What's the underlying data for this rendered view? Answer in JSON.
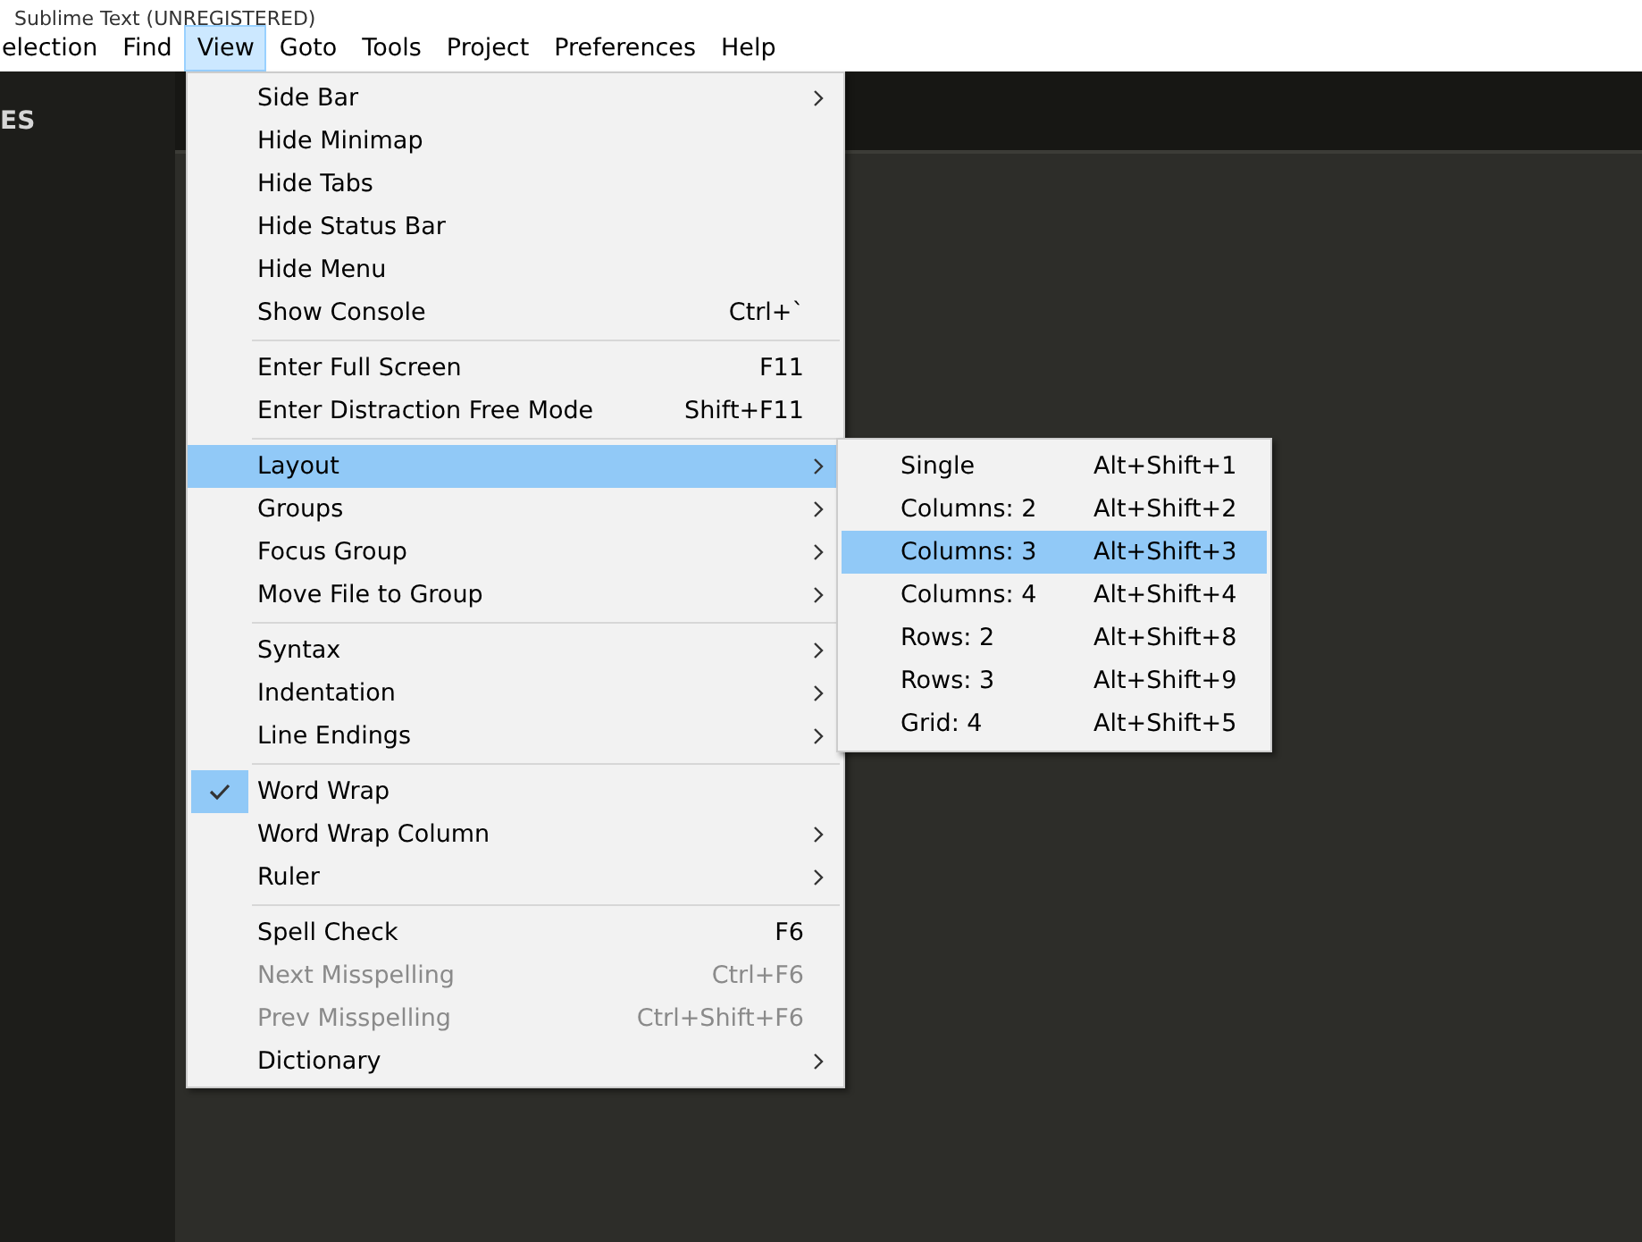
{
  "window": {
    "title": "Sublime Text (UNREGISTERED)"
  },
  "menubar": [
    {
      "label": "election",
      "selected": false
    },
    {
      "label": "Find",
      "selected": false
    },
    {
      "label": "View",
      "selected": true
    },
    {
      "label": "Goto",
      "selected": false
    },
    {
      "label": "Tools",
      "selected": false
    },
    {
      "label": "Project",
      "selected": false
    },
    {
      "label": "Preferences",
      "selected": false
    },
    {
      "label": "Help",
      "selected": false
    }
  ],
  "sidebar": {
    "heading": "ES"
  },
  "view_menu": {
    "sections": [
      [
        {
          "label": "Side Bar",
          "kind": "submenu",
          "selected": false,
          "checked": false,
          "disabled": false
        },
        {
          "label": "Hide Minimap",
          "kind": "item",
          "selected": false,
          "checked": false,
          "disabled": false
        },
        {
          "label": "Hide Tabs",
          "kind": "item",
          "selected": false,
          "checked": false,
          "disabled": false
        },
        {
          "label": "Hide Status Bar",
          "kind": "item",
          "selected": false,
          "checked": false,
          "disabled": false
        },
        {
          "label": "Hide Menu",
          "kind": "item",
          "selected": false,
          "checked": false,
          "disabled": false
        },
        {
          "label": "Show Console",
          "kind": "item",
          "shortcut": "Ctrl+`",
          "selected": false,
          "checked": false,
          "disabled": false
        }
      ],
      [
        {
          "label": "Enter Full Screen",
          "kind": "item",
          "shortcut": "F11",
          "selected": false,
          "checked": false,
          "disabled": false
        },
        {
          "label": "Enter Distraction Free Mode",
          "kind": "item",
          "shortcut": "Shift+F11",
          "selected": false,
          "checked": false,
          "disabled": false
        }
      ],
      [
        {
          "label": "Layout",
          "kind": "submenu",
          "selected": true,
          "checked": false,
          "disabled": false
        },
        {
          "label": "Groups",
          "kind": "submenu",
          "selected": false,
          "checked": false,
          "disabled": false
        },
        {
          "label": "Focus Group",
          "kind": "submenu",
          "selected": false,
          "checked": false,
          "disabled": false
        },
        {
          "label": "Move File to Group",
          "kind": "submenu",
          "selected": false,
          "checked": false,
          "disabled": false
        }
      ],
      [
        {
          "label": "Syntax",
          "kind": "submenu",
          "selected": false,
          "checked": false,
          "disabled": false
        },
        {
          "label": "Indentation",
          "kind": "submenu",
          "selected": false,
          "checked": false,
          "disabled": false
        },
        {
          "label": "Line Endings",
          "kind": "submenu",
          "selected": false,
          "checked": false,
          "disabled": false
        }
      ],
      [
        {
          "label": "Word Wrap",
          "kind": "item",
          "selected": false,
          "checked": true,
          "disabled": false
        },
        {
          "label": "Word Wrap Column",
          "kind": "submenu",
          "selected": false,
          "checked": false,
          "disabled": false
        },
        {
          "label": "Ruler",
          "kind": "submenu",
          "selected": false,
          "checked": false,
          "disabled": false
        }
      ],
      [
        {
          "label": "Spell Check",
          "kind": "item",
          "shortcut": "F6",
          "selected": false,
          "checked": false,
          "disabled": false
        },
        {
          "label": "Next Misspelling",
          "kind": "item",
          "shortcut": "Ctrl+F6",
          "selected": false,
          "checked": false,
          "disabled": true
        },
        {
          "label": "Prev Misspelling",
          "kind": "item",
          "shortcut": "Ctrl+Shift+F6",
          "selected": false,
          "checked": false,
          "disabled": true
        },
        {
          "label": "Dictionary",
          "kind": "submenu",
          "selected": false,
          "checked": false,
          "disabled": false
        }
      ]
    ]
  },
  "layout_submenu": {
    "items": [
      {
        "label": "Single",
        "shortcut": "Alt+Shift+1",
        "selected": false
      },
      {
        "label": "Columns: 2",
        "shortcut": "Alt+Shift+2",
        "selected": false
      },
      {
        "label": "Columns: 3",
        "shortcut": "Alt+Shift+3",
        "selected": true
      },
      {
        "label": "Columns: 4",
        "shortcut": "Alt+Shift+4",
        "selected": false
      },
      {
        "label": "Rows: 2",
        "shortcut": "Alt+Shift+8",
        "selected": false
      },
      {
        "label": "Rows: 3",
        "shortcut": "Alt+Shift+9",
        "selected": false
      },
      {
        "label": "Grid: 4",
        "shortcut": "Alt+Shift+5",
        "selected": false
      }
    ]
  }
}
